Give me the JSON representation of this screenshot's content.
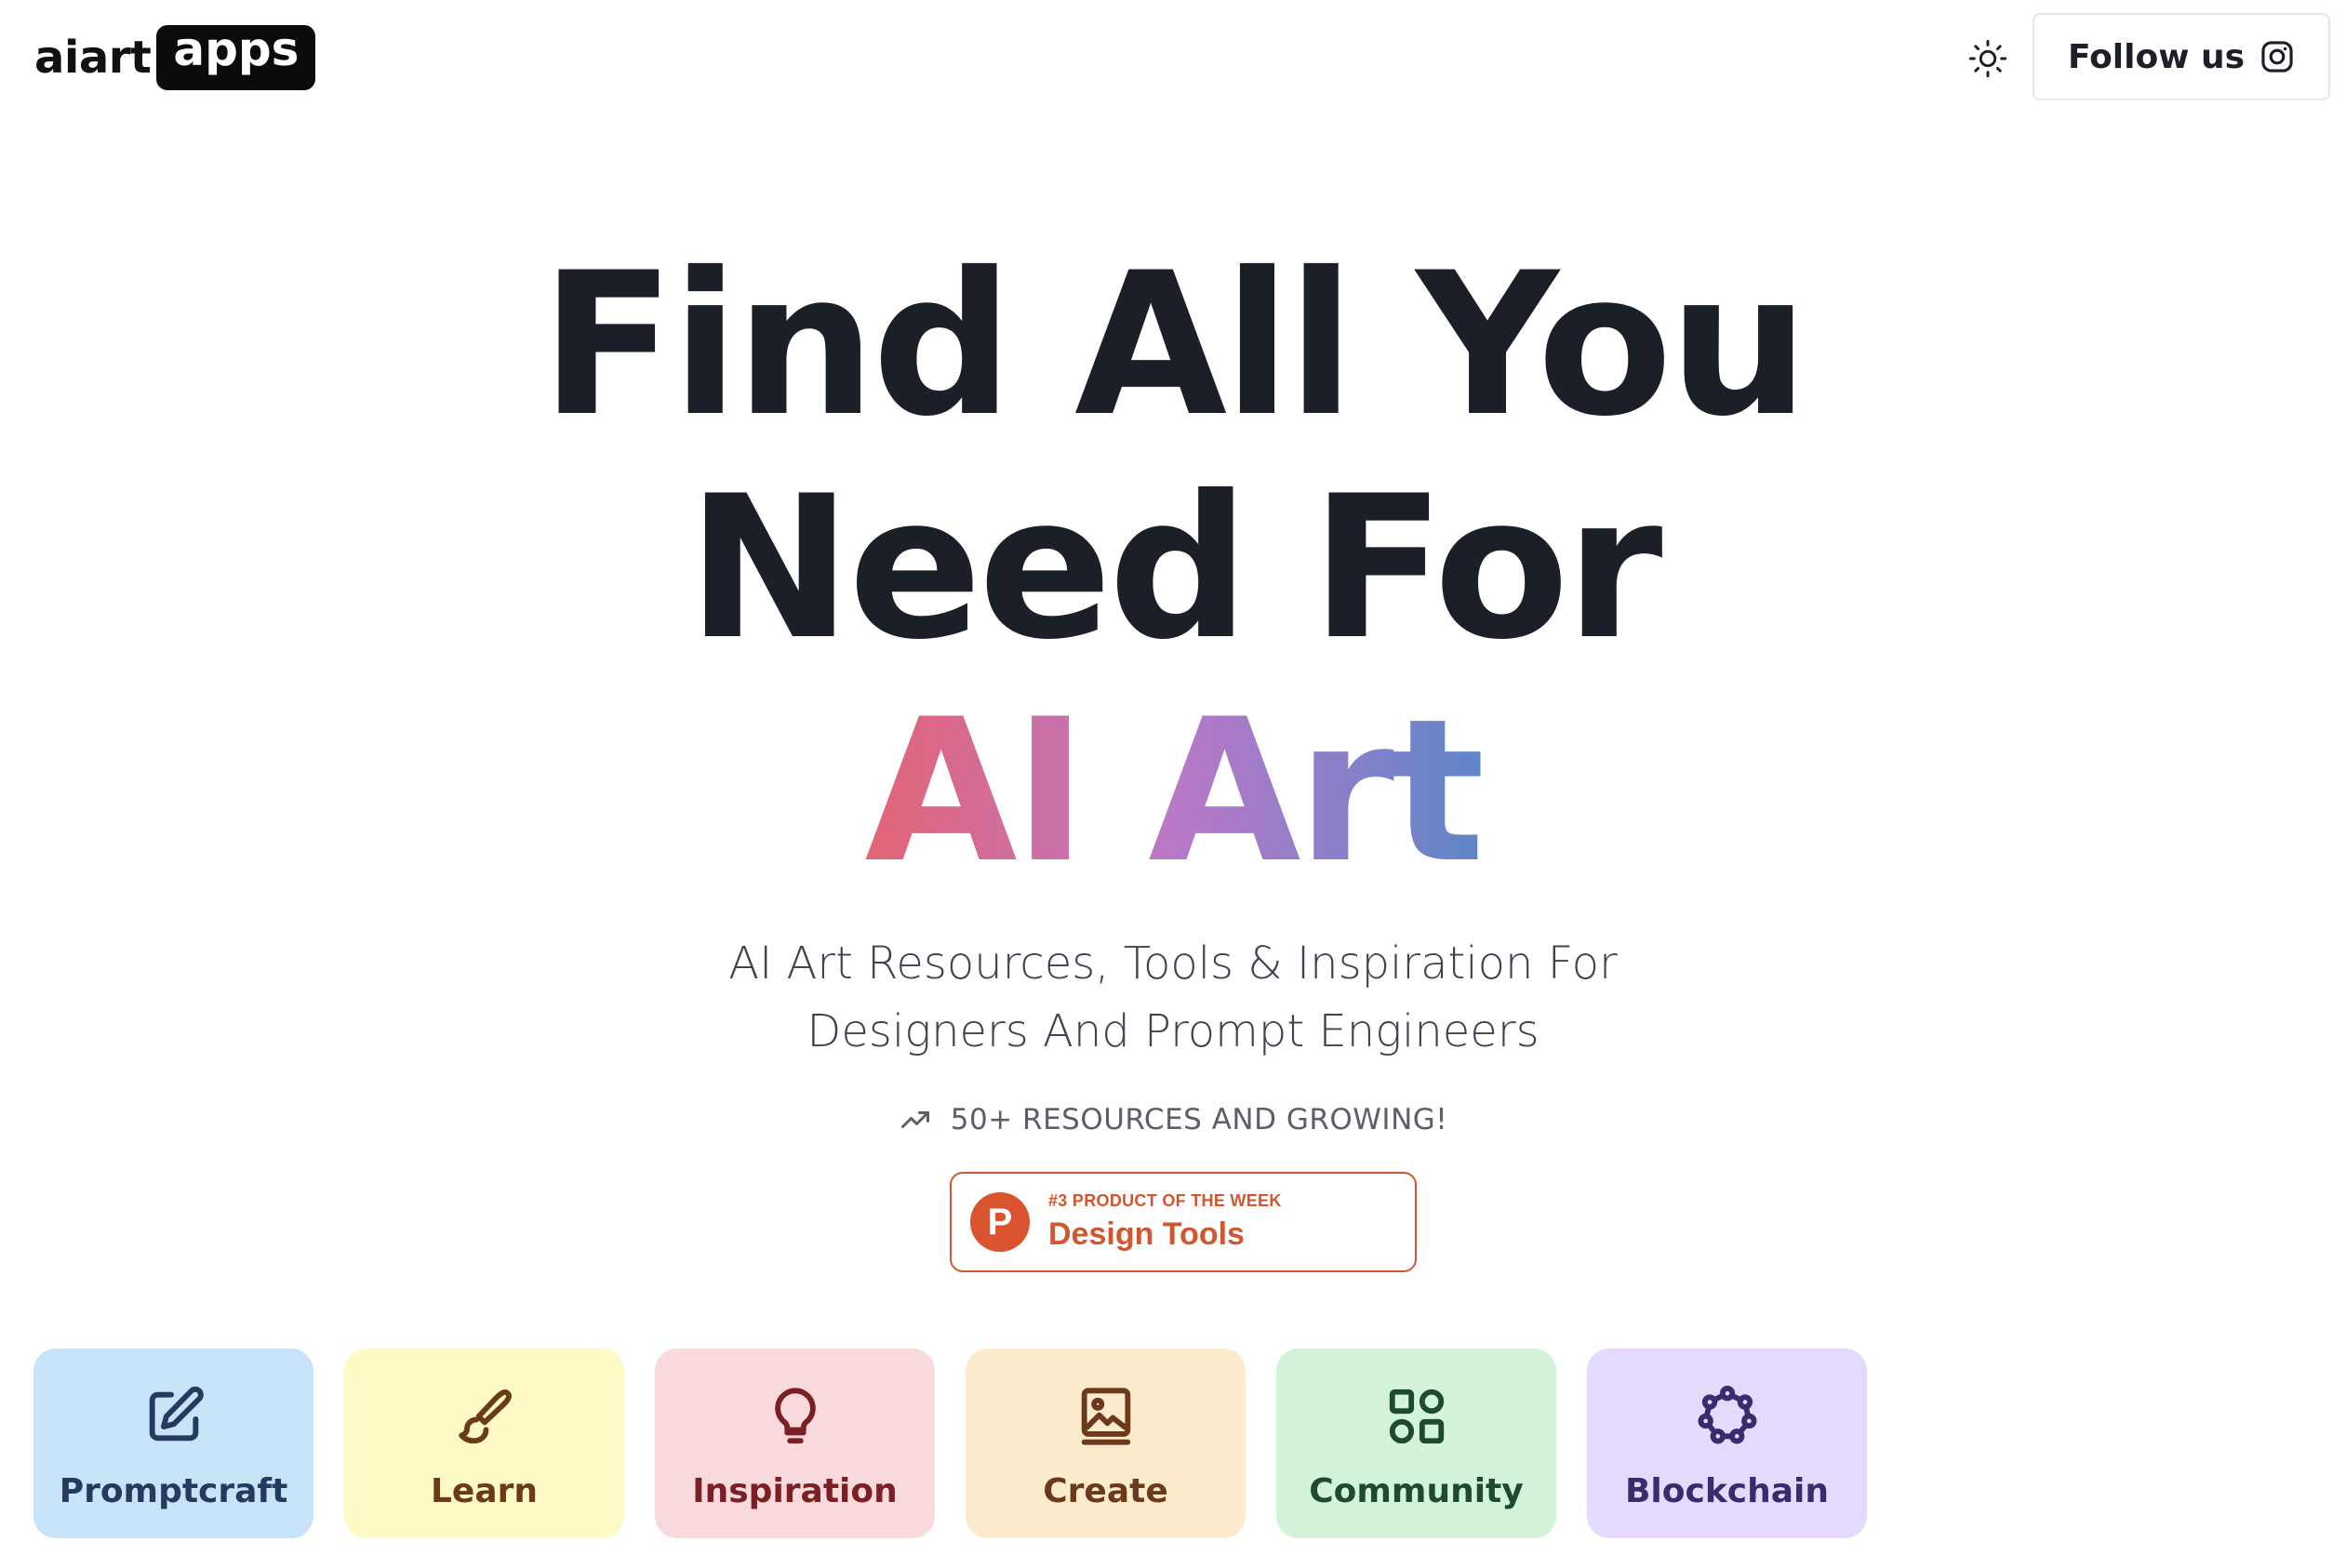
{
  "header": {
    "logo_text": "aiart",
    "logo_box_text": "apps",
    "theme_icon": "sun-icon",
    "follow_label": "Follow us",
    "follow_icon": "instagram-icon"
  },
  "hero": {
    "line1": "Find All You",
    "line2": "Need For",
    "line3": "AI Art",
    "subtitle_line1": "AI Art Resources, Tools & Inspiration For",
    "subtitle_line2": "Designers And Prompt Engineers",
    "resources_text": "50+ RESOURCES AND GROWING!",
    "resources_icon": "trending-up-icon",
    "gradient_colors": [
      "#e46475",
      "#ba78c8",
      "#5f86c9"
    ]
  },
  "badge": {
    "logo_letter": "P",
    "kicker": "#3 PRODUCT OF THE WEEK",
    "title": "Design Tools",
    "color": "#d2562f"
  },
  "categories": [
    {
      "label": "Promptcraft",
      "icon": "edit-icon",
      "bg": "#c8e2f7",
      "fg": "#243a5e"
    },
    {
      "label": "Learn",
      "icon": "brush-icon",
      "bg": "#fefac7",
      "fg": "#6b3b12"
    },
    {
      "label": "Inspiration",
      "icon": "lightbulb-icon",
      "bg": "#f8d9dc",
      "fg": "#7c1f24"
    },
    {
      "label": "Create",
      "icon": "image-book-icon",
      "bg": "#fdebcd",
      "fg": "#6c3a1a"
    },
    {
      "label": "Community",
      "icon": "apps-grid-icon",
      "bg": "#d3f4d8",
      "fg": "#1f4a32"
    },
    {
      "label": "Blockchain",
      "icon": "network-icon",
      "bg": "#e5dafb",
      "fg": "#3a2a6e"
    }
  ]
}
